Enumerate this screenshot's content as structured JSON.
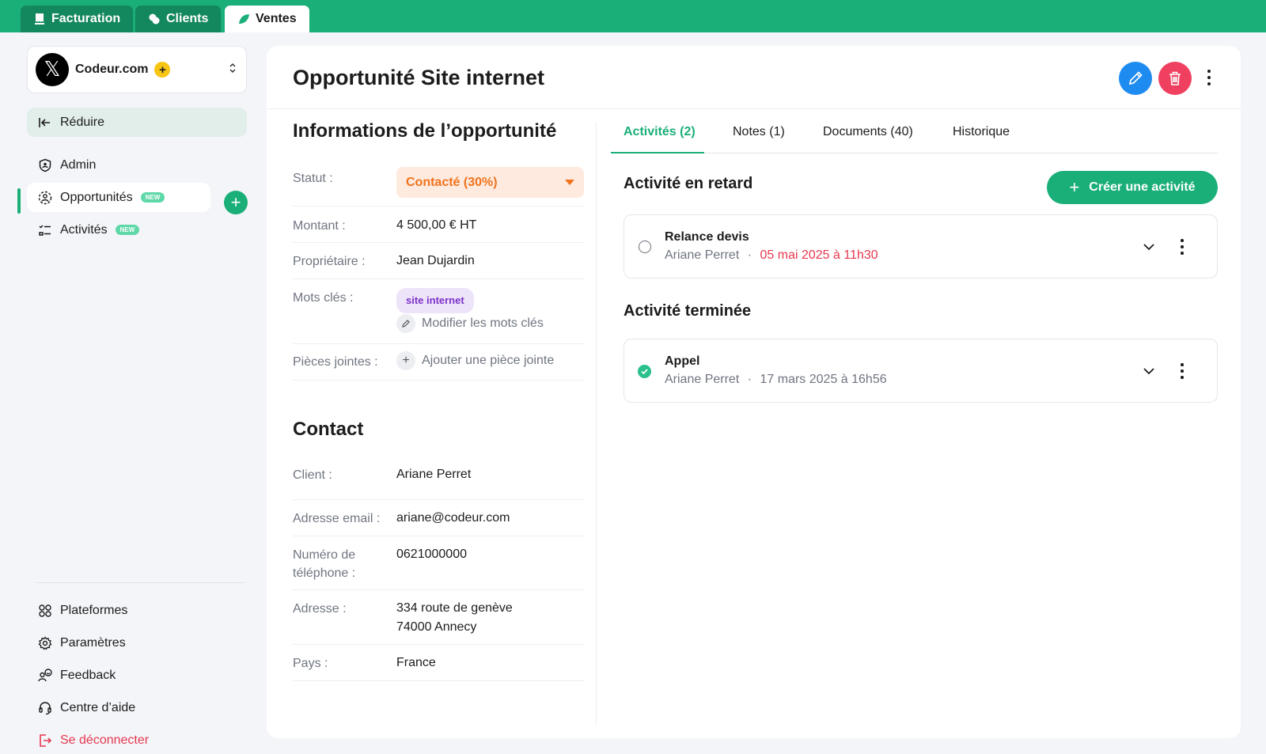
{
  "topbar": {
    "tabs": [
      {
        "label": "Facturation"
      },
      {
        "label": "Clients"
      },
      {
        "label": "Ventes"
      }
    ]
  },
  "sidebar": {
    "org_name": "Codeur.com",
    "org_badge": "+",
    "collapse_label": "Réduire",
    "nav": [
      {
        "label": "Admin"
      },
      {
        "label": "Opportunités",
        "badge": "NEW"
      },
      {
        "label": "Activités",
        "badge": "NEW"
      }
    ],
    "add_label": "+",
    "bottom": [
      {
        "label": "Plateformes"
      },
      {
        "label": "Paramètres"
      },
      {
        "label": "Feedback"
      },
      {
        "label": "Centre d’aide"
      },
      {
        "label": "Se déconnecter"
      }
    ]
  },
  "page": {
    "title": "Opportunité Site internet"
  },
  "info": {
    "title": "Informations de l’opportunité",
    "status_label": "Statut :",
    "status_value": "Contacté (30%)",
    "amount_label": "Montant :",
    "amount_value": "4 500,00 € HT",
    "owner_label": "Propriétaire :",
    "owner_value": "Jean Dujardin",
    "keywords_label": "Mots clés :",
    "keyword_tag": "site internet",
    "edit_keywords": "Modifier les mots clés",
    "attachments_label": "Pièces jointes :",
    "add_attachment": "Ajouter une pièce jointe"
  },
  "contact": {
    "title": "Contact",
    "client_label": "Client :",
    "client_value": "Ariane Perret",
    "email_label": "Adresse email :",
    "email_value": "ariane@codeur.com",
    "phone_label_1": "Numéro de",
    "phone_label_2": "téléphone :",
    "phone_value": "0621000000",
    "address_label": "Adresse :",
    "address_line1": "334 route de genève",
    "address_line2": "74000 Annecy",
    "country_label": "Pays :",
    "country_value": "France"
  },
  "tabs": [
    {
      "label": "Activités (2)"
    },
    {
      "label": "Notes (1)"
    },
    {
      "label": "Documents (40)"
    },
    {
      "label": "Historique"
    }
  ],
  "activities": {
    "late_title": "Activité en retard",
    "create_label": "Créer une activité",
    "late": {
      "title": "Relance devis",
      "person": "Ariane Perret",
      "sep": "·",
      "date": "05 mai 2025 à 11h30"
    },
    "done_title": "Activité terminée",
    "done": {
      "title": "Appel",
      "person": "Ariane Perret",
      "sep": "·",
      "date": "17 mars 2025 à 16h56"
    }
  },
  "colors": {
    "brand": "#1aaf78",
    "edit": "#1e8bf0",
    "delete": "#ef4060",
    "status": "#f0731c",
    "late": "#e5384f"
  }
}
